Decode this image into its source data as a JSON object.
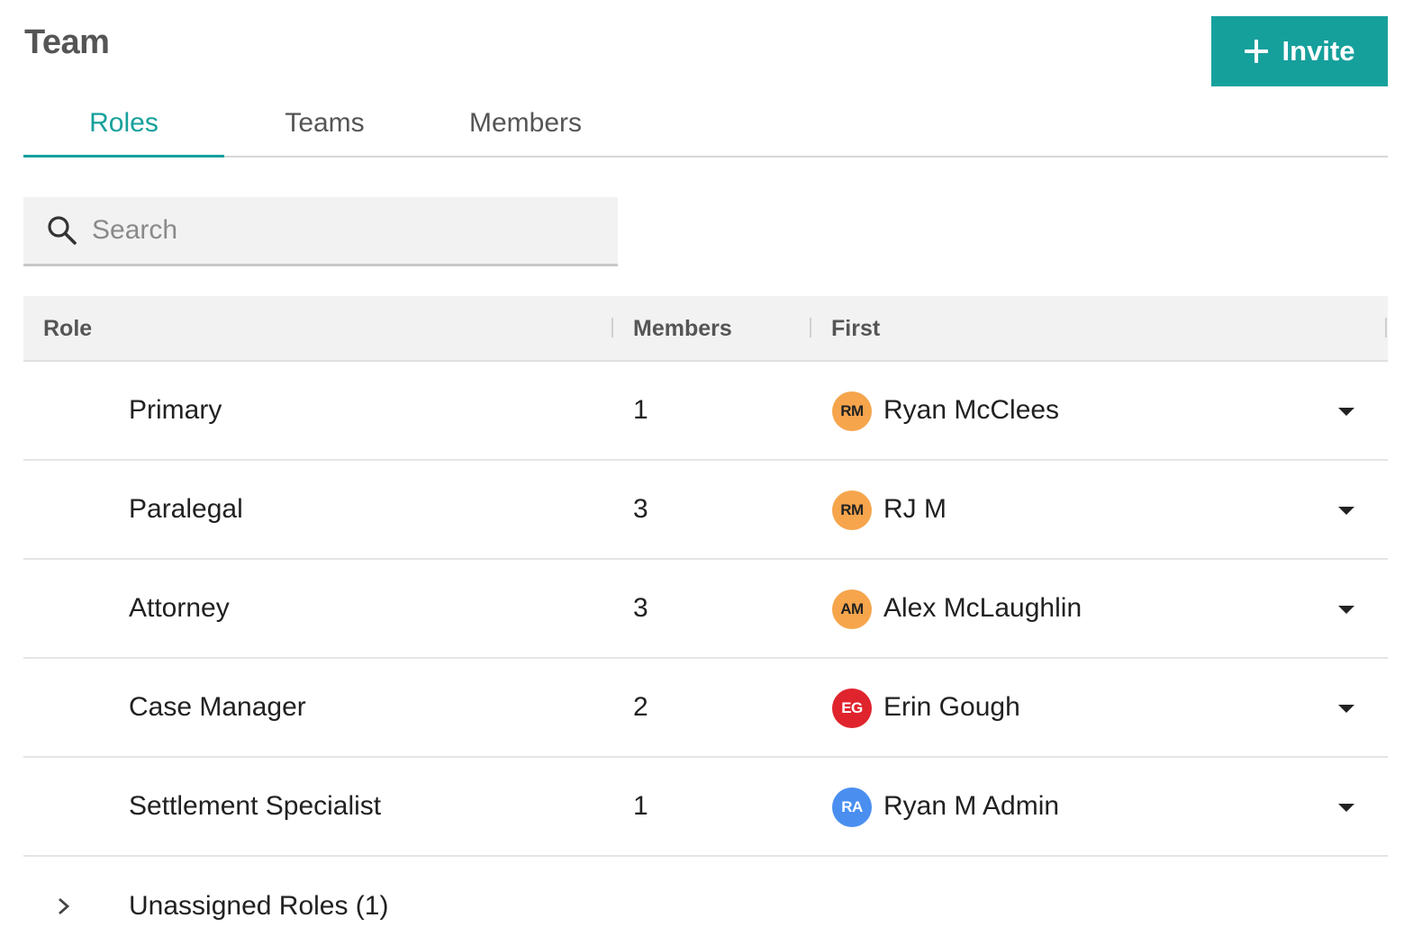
{
  "header": {
    "title": "Team",
    "invite_label": "Invite"
  },
  "tabs": [
    {
      "label": "Roles",
      "active": true
    },
    {
      "label": "Teams",
      "active": false
    },
    {
      "label": "Members",
      "active": false
    }
  ],
  "search": {
    "placeholder": "Search",
    "value": ""
  },
  "table": {
    "columns": [
      "Role",
      "Members",
      "First"
    ],
    "rows": [
      {
        "role": "Primary",
        "members": "1",
        "initials": "RM",
        "avatar_color": "#f6a54c",
        "avatar_text_color": "#222222",
        "first": "Ryan McClees"
      },
      {
        "role": "Paralegal",
        "members": "3",
        "initials": "RM",
        "avatar_color": "#f6a54c",
        "avatar_text_color": "#222222",
        "first": "RJ M"
      },
      {
        "role": "Attorney",
        "members": "3",
        "initials": "AM",
        "avatar_color": "#f6a54c",
        "avatar_text_color": "#222222",
        "first": "Alex McLaughlin"
      },
      {
        "role": "Case Manager",
        "members": "2",
        "initials": "EG",
        "avatar_color": "#e0242e",
        "avatar_text_color": "#ffffff",
        "first": "Erin Gough"
      },
      {
        "role": "Settlement Specialist",
        "members": "1",
        "initials": "RA",
        "avatar_color": "#4a8ff0",
        "avatar_text_color": "#ffffff",
        "first": "Ryan M Admin"
      }
    ],
    "unassigned_label": "Unassigned Roles (1)"
  },
  "icons": {
    "invite": "plus-icon",
    "search": "search-icon",
    "row_menu": "caret-down-icon",
    "expand": "chevron-right-icon"
  },
  "colors": {
    "accent": "#16a09c"
  }
}
